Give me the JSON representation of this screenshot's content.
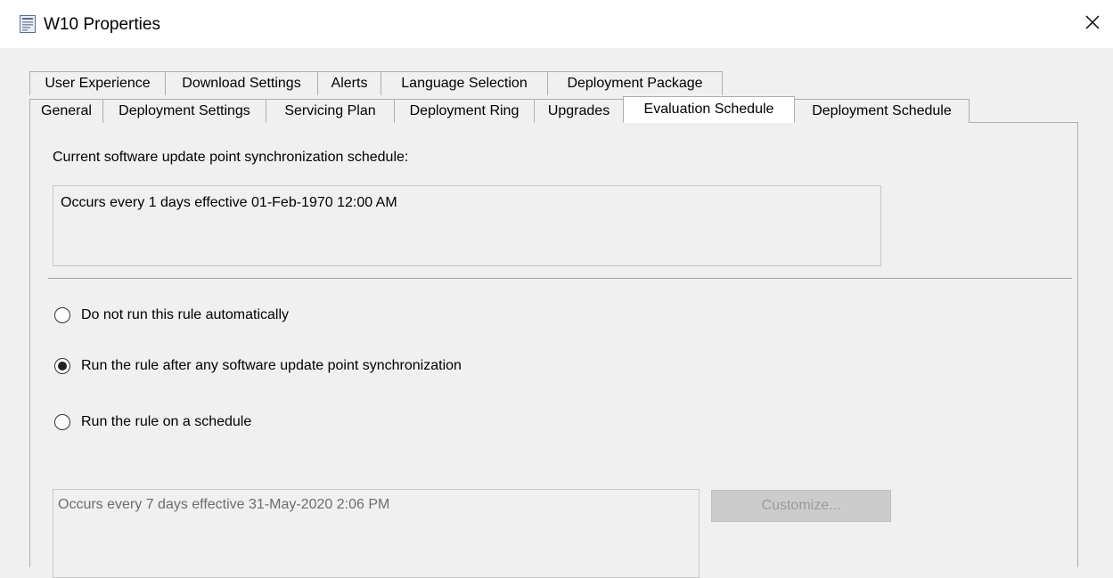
{
  "window": {
    "title": "W10 Properties",
    "close_glyph": "✕"
  },
  "tabs": {
    "row1": [
      "User Experience",
      "Download Settings",
      "Alerts",
      "Language Selection",
      "Deployment Package"
    ],
    "row2": [
      "General",
      "Deployment Settings",
      "Servicing Plan",
      "Deployment Ring",
      "Upgrades",
      "Evaluation Schedule",
      "Deployment Schedule"
    ],
    "selected": "Evaluation Schedule"
  },
  "panel": {
    "sync_label": "Current software update point synchronization schedule:",
    "sync_value": "Occurs every 1 days effective 01-Feb-1970 12:00 AM",
    "radios": [
      {
        "label": "Do not run this rule automatically",
        "checked": false
      },
      {
        "label": "Run the rule after any software update point synchronization",
        "checked": true
      },
      {
        "label": "Run the rule on a schedule",
        "checked": false
      }
    ],
    "schedule_value": "Occurs every 7 days effective 31-May-2020 2:06 PM",
    "customize_label": "Customize..."
  },
  "icons": {
    "window_icon": "properties-window-icon",
    "close": "close-icon"
  }
}
